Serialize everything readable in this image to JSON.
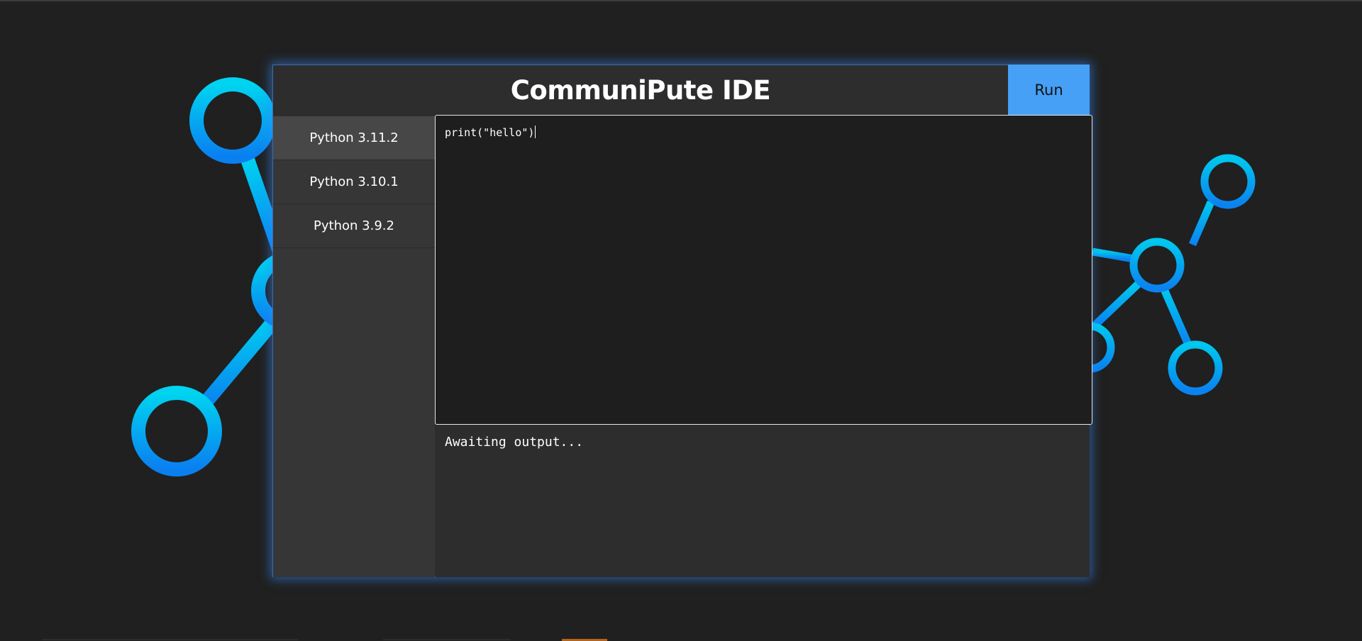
{
  "app": {
    "title": "CommuniPute IDE",
    "run_label": "Run"
  },
  "sidebar": {
    "items": [
      {
        "label": "Python 3.11.2",
        "active": true
      },
      {
        "label": "Python 3.10.1",
        "active": false
      },
      {
        "label": "Python 3.9.2",
        "active": false
      }
    ]
  },
  "editor": {
    "code": "print(\"hello\")"
  },
  "output": {
    "text": "Awaiting output..."
  },
  "colors": {
    "background": "#202020",
    "panel": "#2d2d2d",
    "sidebar": "#363636",
    "sidebar_active": "#474747",
    "editor_bg": "#1e1e1e",
    "accent": "#46a0f5",
    "network_light": "#00d4f0",
    "network_dark": "#0a7ff0",
    "glow": "#348cff"
  },
  "decoration": {
    "background_graphic": "molecule-network-icon"
  }
}
